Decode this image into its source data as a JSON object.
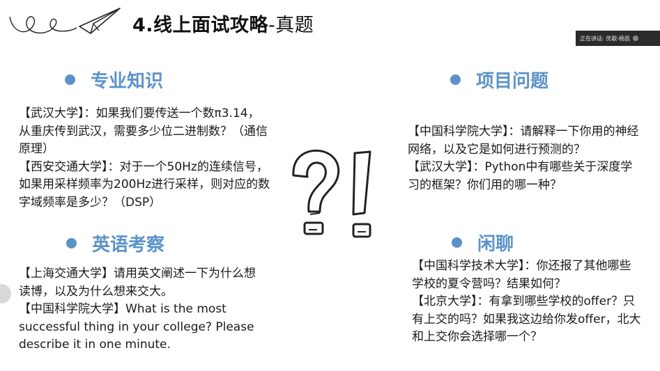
{
  "header": {
    "title": "4.线上面试攻略",
    "title_suffix": "-真题"
  },
  "meeting": {
    "speaking_label": "正在讲话: 优歌-杨凯"
  },
  "sections": {
    "professional": {
      "heading": "专业知识",
      "paragraphs": [
        "【武汉大学】：如果我们要传送一个数π3.14，从重庆传到武汉，需要多少位二进制数？（通信原理）",
        "【西安交通大学】：对于一个50Hz的连续信号，如果用采样频率为200Hz进行采样，则对应的数字域频率是多少？（DSP）"
      ]
    },
    "english": {
      "heading": "英语考察",
      "paragraphs": [
        "【上海交通大学】请用英文阐述一下为什么想读博，以及为什么想来交大。",
        "【中国科学院大学】What is the most successful thing in your college? Please describe it in one minute."
      ]
    },
    "project": {
      "heading": "项目问题",
      "paragraphs": [
        "【中国科学院大学】：请解释一下你用的神经网络，以及它是如何进行预测的？",
        "【武汉大学】：Python中有哪些关于深度学习的框架？你们用的哪一种？"
      ]
    },
    "chat": {
      "heading": "闲聊",
      "paragraphs": [
        "【中国科学技术大学】：你还报了其他哪些学校的夏令营吗？结果如何？",
        "【北京大学】：有拿到哪些学校的offer？只有上交的吗？如果我这边给你发offer，北大和上交你会选择哪一个？"
      ]
    }
  },
  "colors": {
    "accent": "#5b93c9",
    "text": "#1a1a1a"
  }
}
